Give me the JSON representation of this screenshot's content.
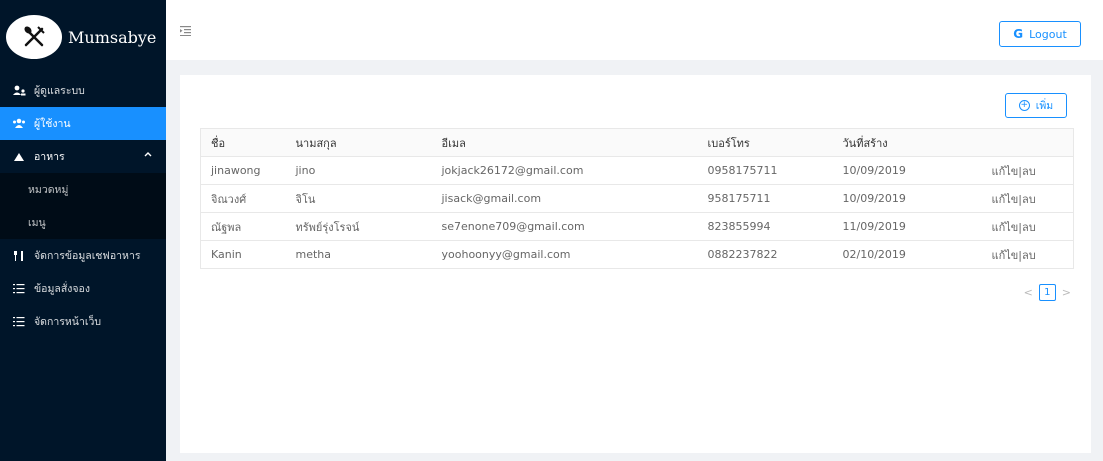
{
  "app": {
    "brand": "Mumsabye"
  },
  "sidebar": {
    "items": [
      {
        "label": "ผู้ดูแลระบบ",
        "icon": "admin-users-icon"
      },
      {
        "label": "ผู้ใช้งาน",
        "icon": "users-icon",
        "active": true
      },
      {
        "label": "อาหาร",
        "icon": "food-triangle-icon",
        "open": true,
        "children": [
          {
            "label": "หมวดหมู่"
          },
          {
            "label": "เมนู"
          }
        ]
      },
      {
        "label": "จัดการข้อมูลเชฟอาหาร",
        "icon": "fork-knife-icon"
      },
      {
        "label": "ข้อมูลสั่งจอง",
        "icon": "list-icon"
      },
      {
        "label": "จัดการหน้าเว็บ",
        "icon": "list-icon"
      }
    ]
  },
  "header": {
    "logout_label": "Logout"
  },
  "main": {
    "add_label": "เพิ่ม",
    "table": {
      "headers": [
        "ชื่อ",
        "นามสกุล",
        "อีเมล",
        "เบอร์โทร",
        "วันที่สร้าง",
        ""
      ],
      "rows": [
        {
          "first": "jinawong",
          "last": "jino",
          "email": "jokjack26172@gmail.com",
          "phone": "0958175711",
          "created": "10/09/2019",
          "action": "แก้ไข|ลบ"
        },
        {
          "first": "จิณวงศ์",
          "last": "จิโน",
          "email": "jisack@gmail.com",
          "phone": "958175711",
          "created": "10/09/2019",
          "action": "แก้ไข|ลบ"
        },
        {
          "first": "ณัฐพล",
          "last": "ทรัพย์รุ่งโรจน์",
          "email": "se7enone709@gmail.com",
          "phone": "823855994",
          "created": "11/09/2019",
          "action": "แก้ไข|ลบ"
        },
        {
          "first": "Kanin",
          "last": "metha",
          "email": "yoohoonyy@gmail.com",
          "phone": "0882237822",
          "created": "02/10/2019",
          "action": "แก้ไข|ลบ"
        }
      ]
    },
    "pagination": {
      "current": "1"
    }
  },
  "colors": {
    "sidebar": "#001529",
    "accent": "#1890ff",
    "background": "#f0f2f5"
  }
}
